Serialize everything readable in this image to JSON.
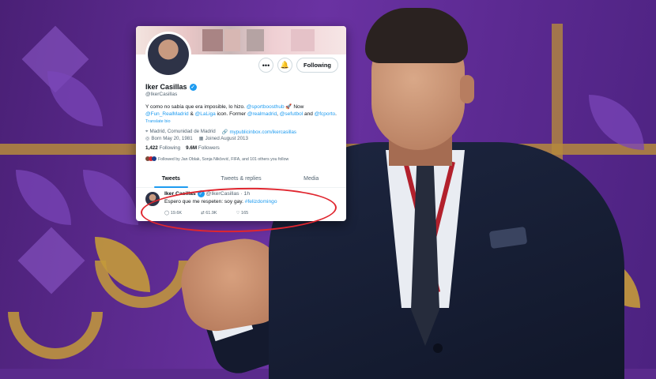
{
  "profile": {
    "name": "Iker Casillas",
    "handle": "@IkerCasillas",
    "follow_button": "Following",
    "more_icon": "more-icon",
    "notify_icon": "bell-icon",
    "bio_text": "Y como no sabía que era imposible, lo hizo.",
    "bio_link1": "@sportboosthub",
    "bio_rocket": "🚀",
    "bio_now": "Now",
    "bio_link2": "@Fun_RealMadrid",
    "bio_amp": "&",
    "bio_link3": "@LaLiga",
    "bio_mid": "icon. Former",
    "bio_link4": "@realmadrid",
    "bio_comma": ",",
    "bio_link5": "@sefutbol",
    "bio_and": "and",
    "bio_link6": "@fcporto",
    "bio_end": ".",
    "translate": "Translate bio",
    "location": "Madrid, Comunidad de Madrid",
    "website": "mypublicinbox.com/ikercasillas",
    "born": "Born May 20, 1981",
    "joined": "Joined August 2013",
    "following_count": "1,422",
    "following_label": "Following",
    "followers_count": "9.6M",
    "followers_label": "Followers",
    "followed_by": "Followed by Jan Oblak, Sonja Nikčević, FIFA, and 101 others you follow"
  },
  "tabs": [
    "Tweets",
    "Tweets & replies",
    "Media"
  ],
  "tweet": {
    "name": "Iker Casillas",
    "handle_time": "@IkerCasillas · 1h",
    "text": "Espero que me respeten: soy gay.",
    "hashtag": "#felizdomingo",
    "replies": "19.6K",
    "retweets": "61.9K",
    "likes": "165"
  },
  "colors": {
    "accent": "#1d9bf0",
    "highlight_circle": "#e0262f",
    "background": "#5a2a8c",
    "gold": "#c49a3a"
  }
}
